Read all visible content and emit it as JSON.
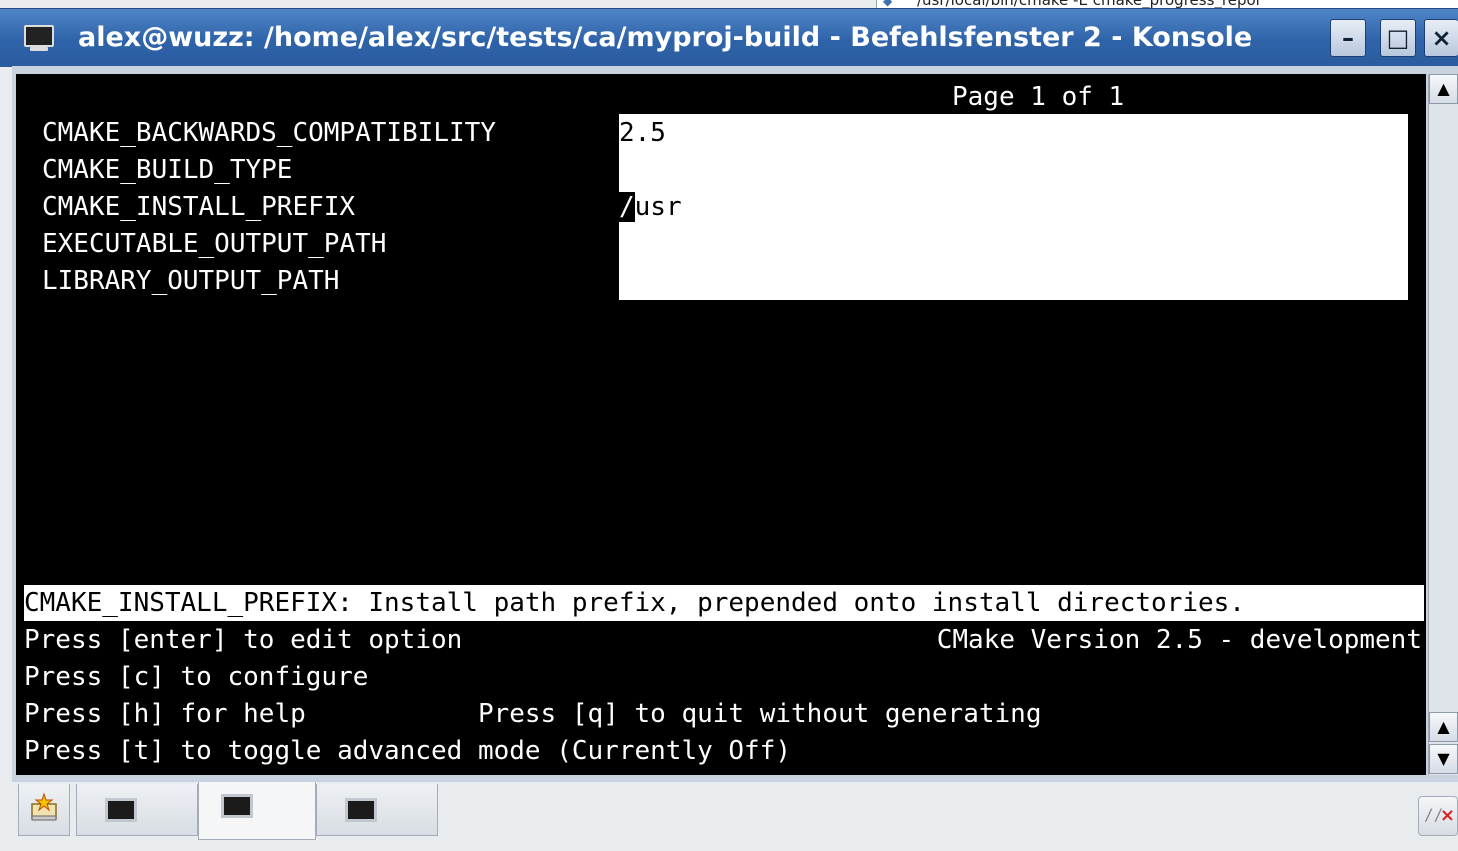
{
  "background_window": {
    "title": "/usr/local/bin/cmake -E cmake_progress_repor"
  },
  "window": {
    "title": "alex@wuzz: /home/alex/src/tests/ca/myproj-build - Befehlsfenster 2 - Konsole",
    "buttons": {
      "minimize": "–",
      "maximize": "□",
      "close": "×"
    }
  },
  "terminal": {
    "page_info": "Page 1 of 1",
    "variables": [
      {
        "name": "CMAKE_BACKWARDS_COMPATIBILITY",
        "value": "2.5"
      },
      {
        "name": "CMAKE_BUILD_TYPE",
        "value": ""
      },
      {
        "name": "CMAKE_INSTALL_PREFIX",
        "value_cursor": "/",
        "value_rest": "usr"
      },
      {
        "name": "EXECUTABLE_OUTPUT_PATH",
        "value": ""
      },
      {
        "name": "LIBRARY_OUTPUT_PATH",
        "value": ""
      }
    ],
    "help_text": "CMAKE_INSTALL_PREFIX: Install path prefix, prepended onto install directories.",
    "instructions": [
      "Press [enter] to edit option",
      "Press [c] to configure",
      "Press [h] for help           Press [q] to quit without generating",
      "Press [t] to toggle advanced mode (Currently Off)"
    ],
    "version": "CMake Version 2.5 - development"
  },
  "scrollbar": {
    "up_arrow": "▲",
    "down_arrow": "▼"
  },
  "tabs": {
    "new_session_icon": "new-session-icon",
    "sessions": [
      "terminal-session-1",
      "terminal-session-2",
      "terminal-session-3"
    ],
    "active_index": 1
  }
}
